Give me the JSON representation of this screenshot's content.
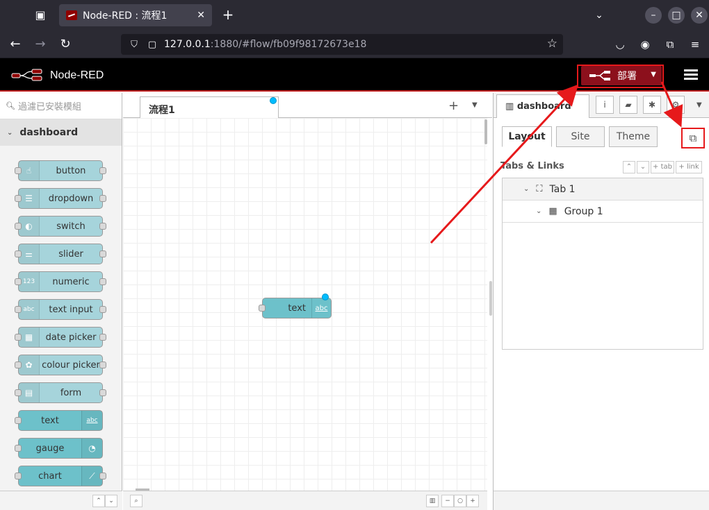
{
  "browser": {
    "tab_title": "Node-RED : 流程1",
    "url_host": "127.0.0.1",
    "url_rest": ":1880/#flow/fb09f98172673e18"
  },
  "header": {
    "app_title": "Node-RED",
    "deploy_label": "部署"
  },
  "palette": {
    "search_placeholder": "過濾已安裝模組",
    "category": "dashboard",
    "nodes": [
      {
        "label": "button",
        "icon": "hand-pointer-icon"
      },
      {
        "label": "dropdown",
        "icon": "list-icon"
      },
      {
        "label": "switch",
        "icon": "toggle-icon"
      },
      {
        "label": "slider",
        "icon": "sliders-icon"
      },
      {
        "label": "numeric",
        "icon": "numeric-icon"
      },
      {
        "label": "text input",
        "icon": "text-input-icon"
      },
      {
        "label": "date picker",
        "icon": "calendar-icon"
      },
      {
        "label": "colour picker",
        "icon": "palette-icon"
      },
      {
        "label": "form",
        "icon": "form-icon"
      },
      {
        "label": "text",
        "icon": "abc-icon"
      },
      {
        "label": "gauge",
        "icon": "gauge-icon"
      },
      {
        "label": "chart",
        "icon": "chart-icon"
      }
    ]
  },
  "workspace": {
    "flow_tab": "流程1",
    "node_label": "text"
  },
  "sidebar": {
    "tab_label": "dashboard",
    "dash_tabs": [
      "Layout",
      "Site",
      "Theme"
    ],
    "section_title": "Tabs & Links",
    "add_tab": "tab",
    "add_link": "link",
    "tree": {
      "tab": "Tab 1",
      "group": "Group 1"
    }
  },
  "colors": {
    "deploy": "#8c101c",
    "highlight": "#e6191b",
    "node_dashboard": "#6dc1ca",
    "node_dashboard_light": "#a6d4db"
  }
}
